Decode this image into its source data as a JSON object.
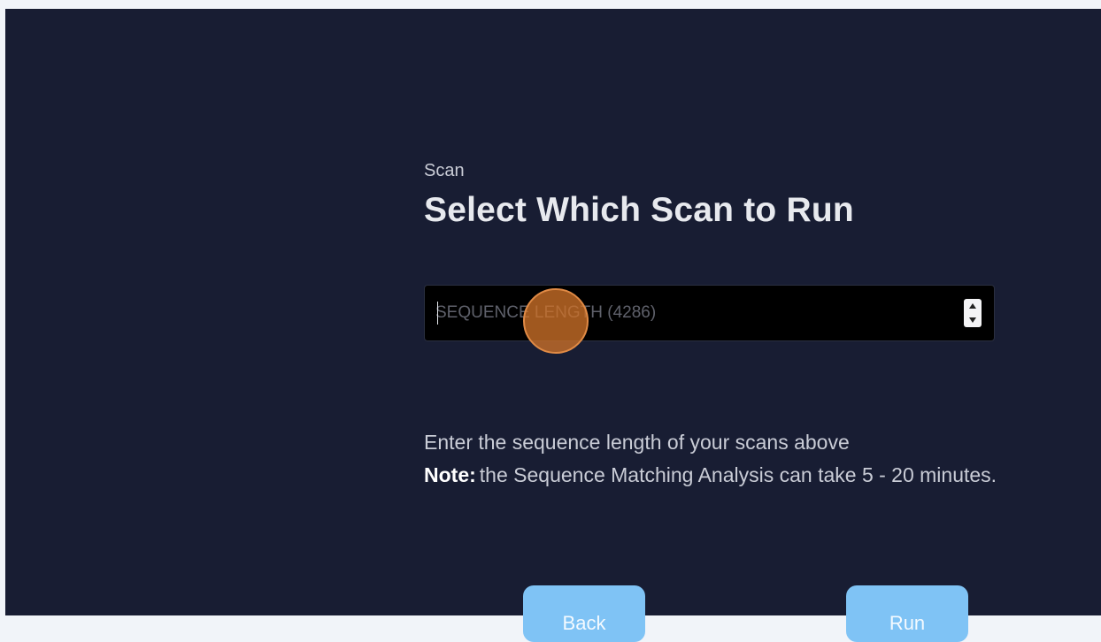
{
  "header": {
    "eyebrow": "Scan",
    "title": "Select Which Scan to Run"
  },
  "sequence_input": {
    "placeholder": "SEQUENCE LENGTH (4286)",
    "value": ""
  },
  "help": {
    "line1": "Enter the sequence length of your scans above",
    "note_label": "Note:",
    "note_text": "the Sequence Matching Analysis can take 5 - 20 minutes."
  },
  "buttons": {
    "back_label": "Back",
    "run_label": "Run"
  },
  "colors": {
    "background": "#181d33",
    "button": "#7fc3f5",
    "click_marker": "#cd7128"
  }
}
